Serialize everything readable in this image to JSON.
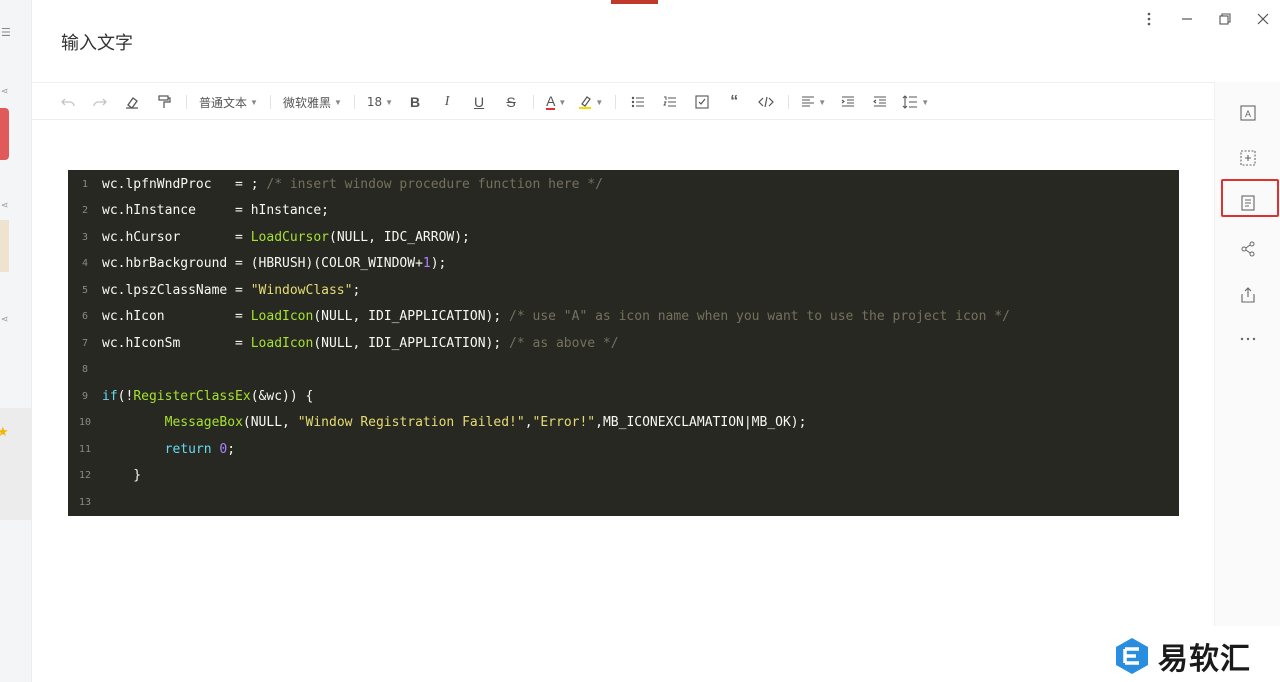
{
  "window": {
    "title": "输入文字"
  },
  "toolbar": {
    "paragraph_style": "普通文本",
    "font_family": "微软雅黑",
    "font_size": "18"
  },
  "code_block": {
    "lines": [
      {
        "n": "1",
        "segs": [
          [
            "wc.lpfnWndProc   = ; ",
            "p"
          ],
          [
            "/* insert window procedure function here */",
            "cm"
          ]
        ]
      },
      {
        "n": "2",
        "segs": [
          [
            "wc.hInstance     = hInstance;",
            "p"
          ]
        ]
      },
      {
        "n": "3",
        "segs": [
          [
            "wc.hCursor       = ",
            "p"
          ],
          [
            "LoadCursor",
            "fn"
          ],
          [
            "(NULL, IDC_ARROW);",
            "p"
          ]
        ]
      },
      {
        "n": "4",
        "segs": [
          [
            "wc.hbrBackground = (HBRUSH)(COLOR_WINDOW+",
            "p"
          ],
          [
            "1",
            "nm"
          ],
          [
            ");",
            "p"
          ]
        ]
      },
      {
        "n": "5",
        "segs": [
          [
            "wc.lpszClassName = ",
            "p"
          ],
          [
            "\"WindowClass\"",
            "st"
          ],
          [
            ";",
            "p"
          ]
        ]
      },
      {
        "n": "6",
        "segs": [
          [
            "wc.hIcon         = ",
            "p"
          ],
          [
            "LoadIcon",
            "fn"
          ],
          [
            "(NULL, IDI_APPLICATION); ",
            "p"
          ],
          [
            "/* use \"A\" as icon name when you want to use the project icon */",
            "cm"
          ]
        ]
      },
      {
        "n": "7",
        "segs": [
          [
            "wc.hIconSm       = ",
            "p"
          ],
          [
            "LoadIcon",
            "fn"
          ],
          [
            "(NULL, IDI_APPLICATION); ",
            "p"
          ],
          [
            "/* as above */",
            "cm"
          ]
        ]
      },
      {
        "n": "8",
        "segs": []
      },
      {
        "n": "9",
        "segs": [
          [
            "if",
            "kw"
          ],
          [
            "(!",
            "p"
          ],
          [
            "RegisterClassEx",
            "fn"
          ],
          [
            "(&wc)) {",
            "p"
          ]
        ]
      },
      {
        "n": "10",
        "segs": [
          [
            "        ",
            "p"
          ],
          [
            "MessageBox",
            "fn"
          ],
          [
            "(NULL, ",
            "p"
          ],
          [
            "\"Window Registration Failed!\"",
            "st"
          ],
          [
            ",",
            "p"
          ],
          [
            "\"Error!\"",
            "st"
          ],
          [
            ",MB_ICONEXCLAMATION|MB_OK);",
            "p"
          ]
        ]
      },
      {
        "n": "11",
        "segs": [
          [
            "        ",
            "p"
          ],
          [
            "return",
            "kw"
          ],
          [
            " ",
            "p"
          ],
          [
            "0",
            "nm"
          ],
          [
            ";",
            "p"
          ]
        ]
      },
      {
        "n": "12",
        "segs": [
          [
            "    }",
            "p"
          ]
        ]
      },
      {
        "n": "13",
        "segs": []
      }
    ]
  },
  "watermark": {
    "text": "易软汇"
  },
  "colors": {
    "highlight_box": "#e03131",
    "code_bg": "#272822"
  }
}
